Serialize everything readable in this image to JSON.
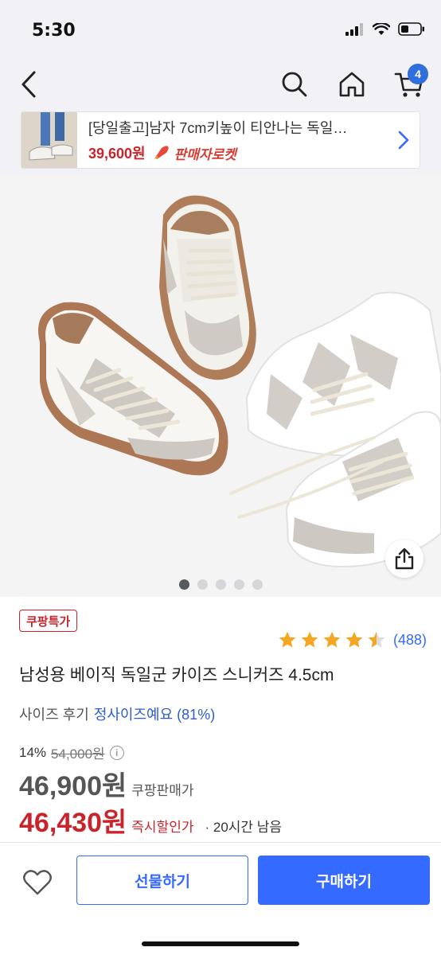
{
  "status_bar": {
    "time": "5:30"
  },
  "nav": {
    "cart_count": "4"
  },
  "banner": {
    "title": "[당일출고]남자 7cm키높이 티안나는 독일…",
    "price": "39,600원",
    "rocket_label": "판매자로켓"
  },
  "gallery": {
    "slide_count": 5,
    "active_index": 0
  },
  "product": {
    "badge": "쿠팡특가",
    "rating_stars": 4.5,
    "rating_count": "(488)",
    "title": "남성용 베이직 독일군 카이즈 스니커즈 4.5cm",
    "size_review_label": "사이즈 후기",
    "size_review_value": "정사이즈예요 (81%)",
    "discount_rate": "14%",
    "original_price": "54,000원",
    "sale_price": "46,900원",
    "sale_label": "쿠팡판매가",
    "instant_price": "46,430원",
    "instant_label": "즉시할인가",
    "time_left": "·  20시간 남음"
  },
  "bottom": {
    "gift_label": "선물하기",
    "buy_label": "구매하기"
  },
  "colors": {
    "accent_blue": "#346aff",
    "price_red": "#c7242b",
    "star_yellow": "#f5a623"
  }
}
